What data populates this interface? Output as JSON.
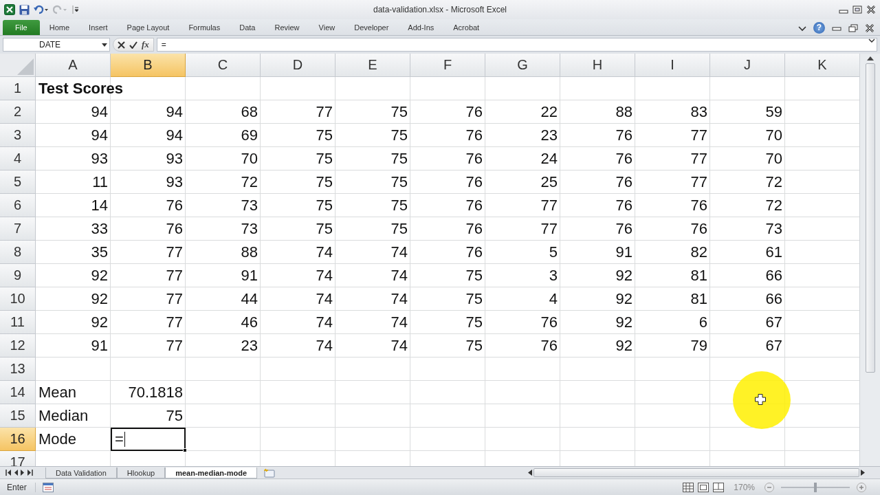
{
  "window": {
    "title": "data-validation.xlsx - Microsoft Excel"
  },
  "ribbon_tabs": [
    {
      "label": "File",
      "kind": "file"
    },
    {
      "label": "Home",
      "kind": "tab"
    },
    {
      "label": "Insert",
      "kind": "tab"
    },
    {
      "label": "Page Layout",
      "kind": "tab"
    },
    {
      "label": "Formulas",
      "kind": "tab"
    },
    {
      "label": "Data",
      "kind": "tab"
    },
    {
      "label": "Review",
      "kind": "tab"
    },
    {
      "label": "View",
      "kind": "tab"
    },
    {
      "label": "Developer",
      "kind": "tab"
    },
    {
      "label": "Add-Ins",
      "kind": "tab"
    },
    {
      "label": "Acrobat",
      "kind": "tab"
    }
  ],
  "help_label": "?",
  "formula_bar": {
    "name_box": "DATE",
    "function_label": "fx",
    "formula": "="
  },
  "sheet": {
    "columns": [
      {
        "label": "A",
        "selected": false
      },
      {
        "label": "B",
        "selected": true
      },
      {
        "label": "C",
        "selected": false
      },
      {
        "label": "D",
        "selected": false
      },
      {
        "label": "E",
        "selected": false
      },
      {
        "label": "F",
        "selected": false
      },
      {
        "label": "G",
        "selected": false
      },
      {
        "label": "H",
        "selected": false
      },
      {
        "label": "I",
        "selected": false
      },
      {
        "label": "J",
        "selected": false
      },
      {
        "label": "K",
        "selected": false
      }
    ],
    "rows": [
      {
        "header": "1",
        "selected": false,
        "cells": [
          {
            "text": "Test Scores",
            "kind": "text",
            "bold": true,
            "selected": false
          }
        ]
      },
      {
        "header": "2",
        "selected": false,
        "cells": [
          {
            "text": "94",
            "selected": false
          },
          {
            "text": "94",
            "selected": false
          },
          {
            "text": "68",
            "selected": false
          },
          {
            "text": "77",
            "selected": false
          },
          {
            "text": "75",
            "selected": false
          },
          {
            "text": "76",
            "selected": false
          },
          {
            "text": "22",
            "selected": false
          },
          {
            "text": "88",
            "selected": false
          },
          {
            "text": "83",
            "selected": false
          },
          {
            "text": "59",
            "selected": false
          }
        ]
      },
      {
        "header": "3",
        "selected": false,
        "cells": [
          {
            "text": "94",
            "selected": false
          },
          {
            "text": "94",
            "selected": false
          },
          {
            "text": "69",
            "selected": false
          },
          {
            "text": "75",
            "selected": false
          },
          {
            "text": "75",
            "selected": false
          },
          {
            "text": "76",
            "selected": false
          },
          {
            "text": "23",
            "selected": false
          },
          {
            "text": "76",
            "selected": false
          },
          {
            "text": "77",
            "selected": false
          },
          {
            "text": "70",
            "selected": false
          }
        ]
      },
      {
        "header": "4",
        "selected": false,
        "cells": [
          {
            "text": "93",
            "selected": false
          },
          {
            "text": "93",
            "selected": false
          },
          {
            "text": "70",
            "selected": false
          },
          {
            "text": "75",
            "selected": false
          },
          {
            "text": "75",
            "selected": false
          },
          {
            "text": "76",
            "selected": false
          },
          {
            "text": "24",
            "selected": false
          },
          {
            "text": "76",
            "selected": false
          },
          {
            "text": "77",
            "selected": false
          },
          {
            "text": "70",
            "selected": false
          }
        ]
      },
      {
        "header": "5",
        "selected": false,
        "cells": [
          {
            "text": "11",
            "selected": false
          },
          {
            "text": "93",
            "selected": false
          },
          {
            "text": "72",
            "selected": false
          },
          {
            "text": "75",
            "selected": false
          },
          {
            "text": "75",
            "selected": false
          },
          {
            "text": "76",
            "selected": false
          },
          {
            "text": "25",
            "selected": false
          },
          {
            "text": "76",
            "selected": false
          },
          {
            "text": "77",
            "selected": false
          },
          {
            "text": "72",
            "selected": false
          }
        ]
      },
      {
        "header": "6",
        "selected": false,
        "cells": [
          {
            "text": "14",
            "selected": false
          },
          {
            "text": "76",
            "selected": false
          },
          {
            "text": "73",
            "selected": false
          },
          {
            "text": "75",
            "selected": false
          },
          {
            "text": "75",
            "selected": false
          },
          {
            "text": "76",
            "selected": false
          },
          {
            "text": "77",
            "selected": false
          },
          {
            "text": "76",
            "selected": false
          },
          {
            "text": "76",
            "selected": false
          },
          {
            "text": "72",
            "selected": false
          }
        ]
      },
      {
        "header": "7",
        "selected": false,
        "cells": [
          {
            "text": "33",
            "selected": false
          },
          {
            "text": "76",
            "selected": false
          },
          {
            "text": "73",
            "selected": false
          },
          {
            "text": "75",
            "selected": false
          },
          {
            "text": "75",
            "selected": false
          },
          {
            "text": "76",
            "selected": false
          },
          {
            "text": "77",
            "selected": false
          },
          {
            "text": "76",
            "selected": false
          },
          {
            "text": "76",
            "selected": false
          },
          {
            "text": "73",
            "selected": false
          }
        ]
      },
      {
        "header": "8",
        "selected": false,
        "cells": [
          {
            "text": "35",
            "selected": false
          },
          {
            "text": "77",
            "selected": false
          },
          {
            "text": "88",
            "selected": false
          },
          {
            "text": "74",
            "selected": false
          },
          {
            "text": "74",
            "selected": false
          },
          {
            "text": "76",
            "selected": false
          },
          {
            "text": "5",
            "selected": false
          },
          {
            "text": "91",
            "selected": false
          },
          {
            "text": "82",
            "selected": false
          },
          {
            "text": "61",
            "selected": false
          }
        ]
      },
      {
        "header": "9",
        "selected": false,
        "cells": [
          {
            "text": "92",
            "selected": false
          },
          {
            "text": "77",
            "selected": false
          },
          {
            "text": "91",
            "selected": false
          },
          {
            "text": "74",
            "selected": false
          },
          {
            "text": "74",
            "selected": false
          },
          {
            "text": "75",
            "selected": false
          },
          {
            "text": "3",
            "selected": false
          },
          {
            "text": "92",
            "selected": false
          },
          {
            "text": "81",
            "selected": false
          },
          {
            "text": "66",
            "selected": false
          }
        ]
      },
      {
        "header": "10",
        "selected": false,
        "cells": [
          {
            "text": "92",
            "selected": false
          },
          {
            "text": "77",
            "selected": false
          },
          {
            "text": "44",
            "selected": false
          },
          {
            "text": "74",
            "selected": false
          },
          {
            "text": "74",
            "selected": false
          },
          {
            "text": "75",
            "selected": false
          },
          {
            "text": "4",
            "selected": false
          },
          {
            "text": "92",
            "selected": false
          },
          {
            "text": "81",
            "selected": false
          },
          {
            "text": "66",
            "selected": false
          }
        ]
      },
      {
        "header": "11",
        "selected": false,
        "cells": [
          {
            "text": "92",
            "selected": false
          },
          {
            "text": "77",
            "selected": false
          },
          {
            "text": "46",
            "selected": false
          },
          {
            "text": "74",
            "selected": false
          },
          {
            "text": "74",
            "selected": false
          },
          {
            "text": "75",
            "selected": false
          },
          {
            "text": "76",
            "selected": false
          },
          {
            "text": "92",
            "selected": false
          },
          {
            "text": "6",
            "selected": false
          },
          {
            "text": "67",
            "selected": false
          }
        ]
      },
      {
        "header": "12",
        "selected": false,
        "cells": [
          {
            "text": "91",
            "selected": false
          },
          {
            "text": "77",
            "selected": false
          },
          {
            "text": "23",
            "selected": false
          },
          {
            "text": "74",
            "selected": false
          },
          {
            "text": "74",
            "selected": false
          },
          {
            "text": "75",
            "selected": false
          },
          {
            "text": "76",
            "selected": false
          },
          {
            "text": "92",
            "selected": false
          },
          {
            "text": "79",
            "selected": false
          },
          {
            "text": "67",
            "selected": false
          }
        ]
      },
      {
        "header": "13",
        "selected": false
      },
      {
        "header": "14",
        "selected": false,
        "cells": [
          {
            "text": "Mean",
            "kind": "text",
            "selected": false
          },
          {
            "text": "70.1818",
            "kind": "number",
            "selected": false
          }
        ]
      },
      {
        "header": "15",
        "selected": false,
        "cells": [
          {
            "text": "Median",
            "kind": "text",
            "selected": false
          },
          {
            "text": "75",
            "kind": "number",
            "selected": false
          }
        ]
      },
      {
        "header": "16",
        "selected": true,
        "cells": [
          {
            "text": "Mode",
            "kind": "text",
            "selected": false
          },
          {
            "text": "=",
            "kind": "text",
            "selected": true
          }
        ]
      },
      {
        "header": "17",
        "selected": false
      }
    ]
  },
  "sheet_tabs": [
    {
      "label": "Data Validation",
      "selected": false
    },
    {
      "label": "Hlookup",
      "selected": false
    },
    {
      "label": "mean-median-mode",
      "selected": true
    }
  ],
  "status_bar": {
    "mode": "Enter",
    "zoom": {
      "text": "170%",
      "level": 0.5
    }
  }
}
